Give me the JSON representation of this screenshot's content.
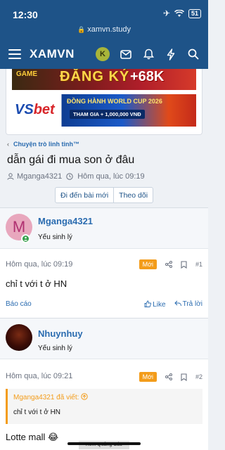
{
  "status": {
    "time": "12:30",
    "battery": "51"
  },
  "browser": {
    "url": "xamvn.study"
  },
  "nav": {
    "logo": "XAMVN",
    "avatar_letter": "K"
  },
  "banners": {
    "top": {
      "left": "GAME",
      "main": "ĐĂNG KÝ",
      "promo": "+68K"
    },
    "bottom": {
      "brand_a": "VS",
      "brand_b": "bet",
      "headline": "ĐỒNG HÀNH WORLD CUP 2026",
      "offer": "THAM GIA + 1,000,000 VNĐ"
    }
  },
  "thread": {
    "breadcrumb": "Chuyện trò linh tinh™",
    "title": "dẫn gái đi mua son ở đâu",
    "author": "Mganga4321",
    "date": "Hôm qua, lúc 09:19",
    "btn_unread": "Đi đến bài mới",
    "btn_watch": "Theo dõi"
  },
  "posts": [
    {
      "username": "Mganga4321",
      "avatar_letter": "M",
      "role": "Yếu sinh lý",
      "time": "Hôm qua, lúc 09:19",
      "badge": "Mới",
      "number": "#1",
      "text": "chỉ t với t ở HN",
      "report": "Báo cáo",
      "like": "Like",
      "reply": "Trả lời"
    },
    {
      "username": "Nhuynhuy",
      "role": "Yếu sinh lý",
      "time": "Hôm qua, lúc 09:21",
      "badge": "Mới",
      "number": "#2",
      "quote_author": "Mganga4321 đã viết:",
      "quote_text": "chỉ t với t ở HN",
      "text": "Lotte mall 😂"
    }
  ],
  "ad": {
    "close_label": "Xem Quảng Cáo"
  },
  "colors": {
    "primary": "#1e5388",
    "link": "#2b6cb0",
    "badge": "#f39c1a",
    "online": "#36a04b"
  }
}
